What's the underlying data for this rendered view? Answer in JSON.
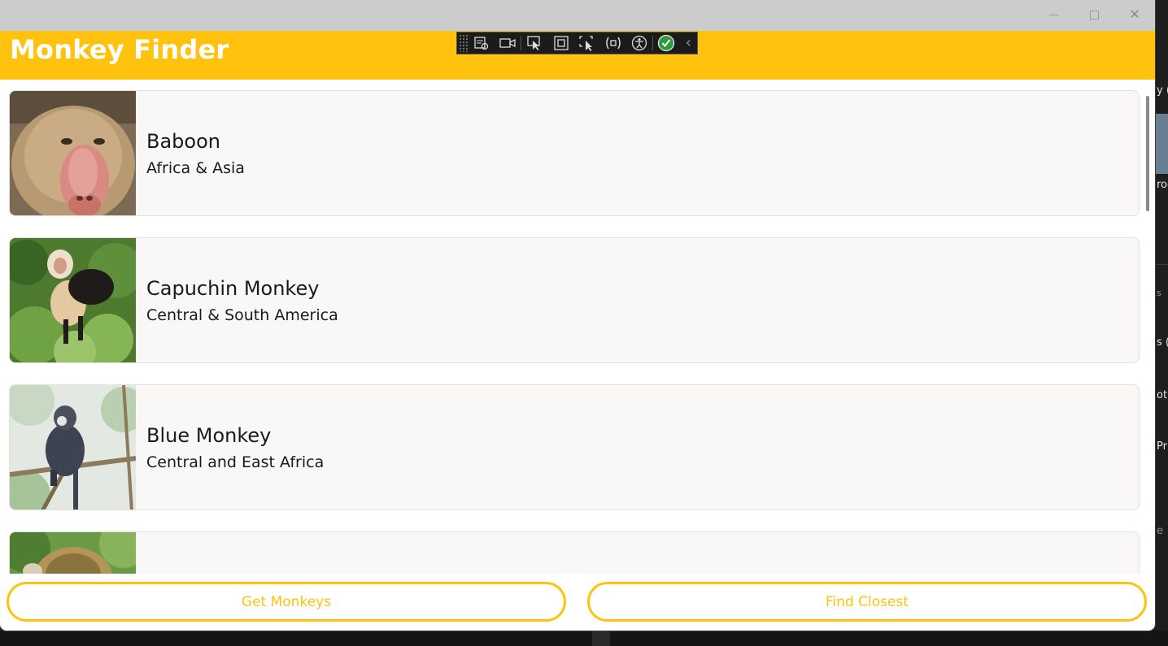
{
  "app": {
    "title": "Monkey Finder"
  },
  "window_controls": {
    "minimize_icon": "minimize-icon",
    "maximize_icon": "maximize-icon",
    "close_icon": "close-icon",
    "close_glyph": "✕"
  },
  "debug_toolbar": {
    "icons": [
      "live-visual-tree-icon",
      "video-camera-icon",
      "select-element-icon",
      "display-layout-adorners-icon",
      "track-focused-element-icon",
      "binding-failures-icon",
      "accessibility-icon",
      "check-icon"
    ],
    "collapse_glyph": "‹"
  },
  "monkeys": [
    {
      "name": "Baboon",
      "location": "Africa & Asia",
      "photo": "baboon-photo"
    },
    {
      "name": "Capuchin Monkey",
      "location": "Central & South America",
      "photo": "capuchin-photo"
    },
    {
      "name": "Blue Monkey",
      "location": "Central and East Africa",
      "photo": "blue-monkey-photo"
    },
    {
      "name": "",
      "location": "",
      "photo": "squirrel-monkey-photo"
    }
  ],
  "buttons": {
    "get_monkeys": "Get Monkeys",
    "find_closest": "Find Closest"
  },
  "background": {
    "fragments": [
      "y (",
      "roc",
      "s",
      "s (",
      "ot",
      "Pr",
      "e"
    ]
  },
  "colors": {
    "accent": "#ffc20e",
    "title_bar": "#cccccc",
    "card_background": "#f9f8f7"
  }
}
